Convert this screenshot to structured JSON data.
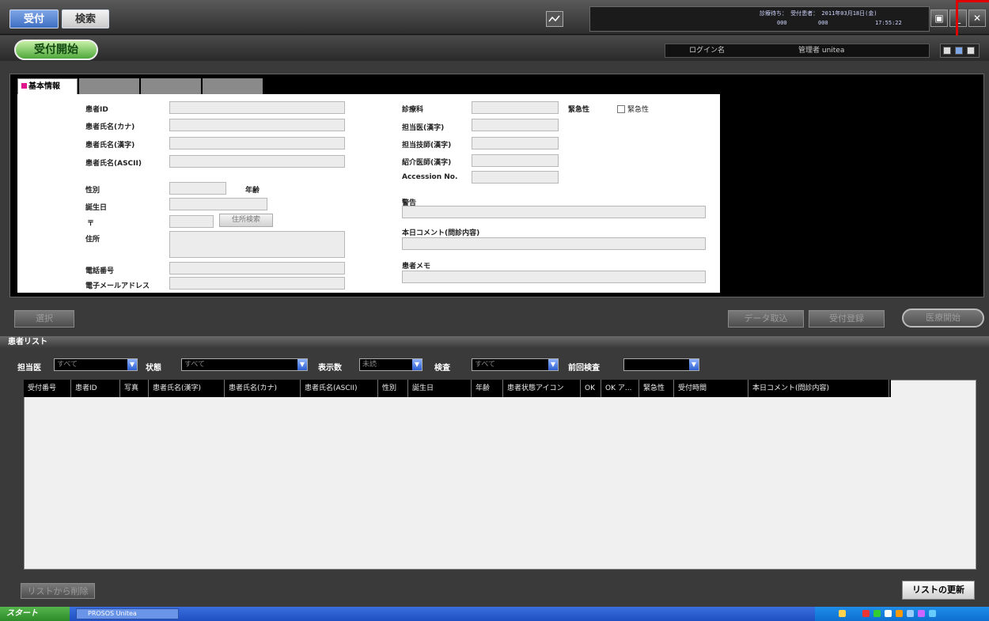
{
  "toolbar": {
    "reception_label": "受付",
    "search_label": "検索"
  },
  "status": {
    "line1": "診療待ち： 受付患者： 2011年03月18日(金)",
    "line2_a": "000",
    "line2_b": "000",
    "line2_c": "17:55:22"
  },
  "window": {
    "buttons": [
      "▣",
      "_",
      "✕"
    ]
  },
  "header": {
    "start_label": "受付開始",
    "login_label": "ログイン名",
    "login_value": "管理者 unitea"
  },
  "tabs": {
    "basic": "基本情報",
    "others": [
      "",
      "",
      ""
    ]
  },
  "form": {
    "left_labels": {
      "patient_id": "患者ID",
      "name_kana": "患者氏名(カナ)",
      "name_kanji": "患者氏名(漢字)",
      "name_ascii": "患者氏名(ASCII)",
      "sex": "性別",
      "age": "年齢",
      "birthday": "誕生日",
      "postal": "〒",
      "address": "住所",
      "phone": "電話番号",
      "email": "電子メールアドレス"
    },
    "address_search_label": "住所検索",
    "right_labels": {
      "department": "診療科",
      "urgency": "緊急性",
      "urgency_check": "緊急性",
      "dept_in_charge": "担当医(漢字)",
      "tech_in_charge": "担当技師(漢字)",
      "referring_doctor": "紹介医師(漢字)",
      "accession": "Accession No.",
      "warning": "警告",
      "today_comment": "本日コメント(問診内容)",
      "patient_memo": "患者メモ"
    }
  },
  "actions": {
    "select_label": "選択",
    "data_read_label": "データ取込",
    "register_label": "受付登録",
    "exam_start_label": "医療開始"
  },
  "patient_list": {
    "title": "患者リスト",
    "filters": [
      {
        "label": "担当医",
        "value": "すべて"
      },
      {
        "label": "状態",
        "value": "すべて"
      },
      {
        "label": "表示数",
        "value": "未読"
      },
      {
        "label": "検査",
        "value": "すべて"
      },
      {
        "label": "前回検査",
        "value": ""
      }
    ],
    "columns": [
      "受付番号",
      "患者ID",
      "写真",
      "患者氏名(漢字)",
      "患者氏名(カナ)",
      "患者氏名(ASCII)",
      "性別",
      "誕生日",
      "年齢",
      "患者状態アイコン",
      "OK",
      "OK ア...",
      "緊急性",
      "受付時間",
      "本日コメント(問診内容)"
    ],
    "remove_label": "リストから削除",
    "refresh_label": "リストの更新"
  },
  "taskbar": {
    "start_label": "スタート",
    "task_label": "PROSOS Unitea"
  },
  "colors": {
    "accent_blue": "#3f6fc4",
    "start_green": "#4ea83a",
    "annotation_red": "#e00000",
    "tab_marker": "#e0148c"
  }
}
